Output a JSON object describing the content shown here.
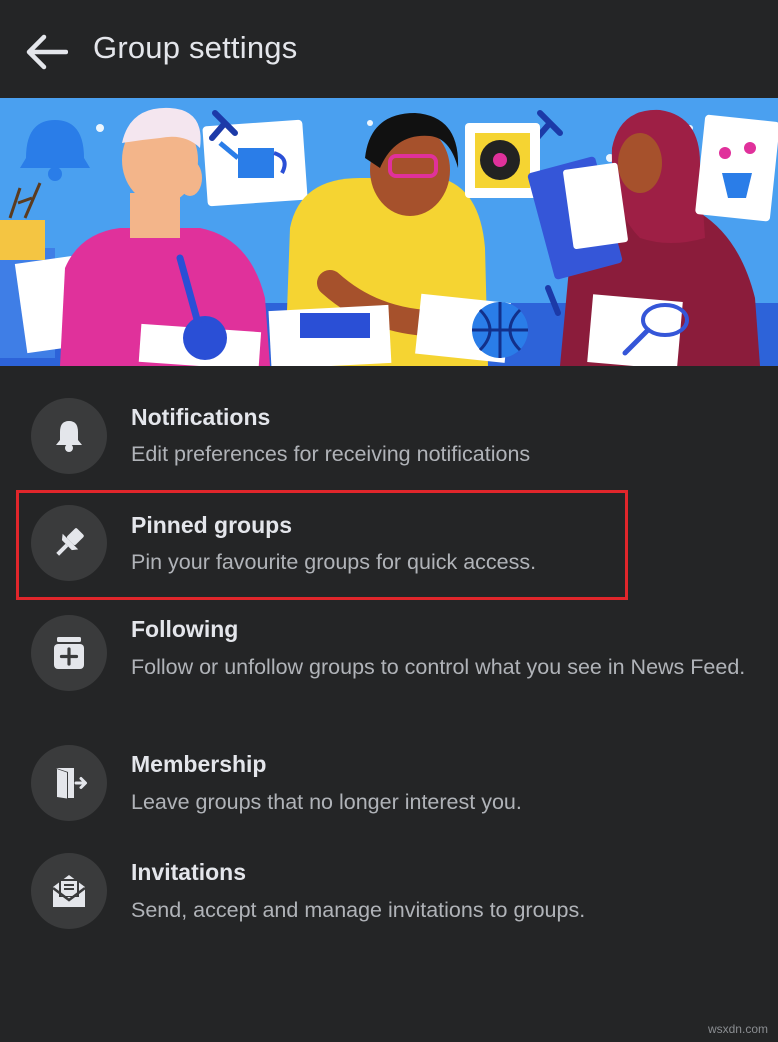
{
  "header": {
    "title": "Group settings",
    "back_icon": "arrow-left-icon"
  },
  "banner": {
    "description_icons": [
      "bell-icon",
      "pushpin-icon",
      "watering-can-icon",
      "record-player-icon",
      "flower-pot-icon",
      "basketball-icon",
      "tennis-racket-icon"
    ]
  },
  "menu": {
    "items": [
      {
        "title": "Notifications",
        "desc": "Edit preferences for receiving notifications",
        "icon": "bell-icon"
      },
      {
        "title": "Pinned groups",
        "desc": "Pin your favourite groups for quick access.",
        "icon": "pushpin-icon"
      },
      {
        "title": "Following",
        "desc": "Follow or unfollow groups to control what you see in News Feed.",
        "icon": "add-folder-icon"
      },
      {
        "title": "Membership",
        "desc": "Leave groups that no longer interest you.",
        "icon": "exit-door-icon"
      },
      {
        "title": "Invitations",
        "desc": "Send, accept and manage invitations to groups.",
        "icon": "envelope-icon"
      }
    ]
  },
  "watermark": "wsxdn.com",
  "colors": {
    "background": "#242526",
    "icon_circle": "#3a3b3c",
    "title_text": "#e4e6eb",
    "desc_text": "#b0b3b8",
    "highlight": "#e0262b",
    "banner_sky": "#4aa0f0"
  }
}
